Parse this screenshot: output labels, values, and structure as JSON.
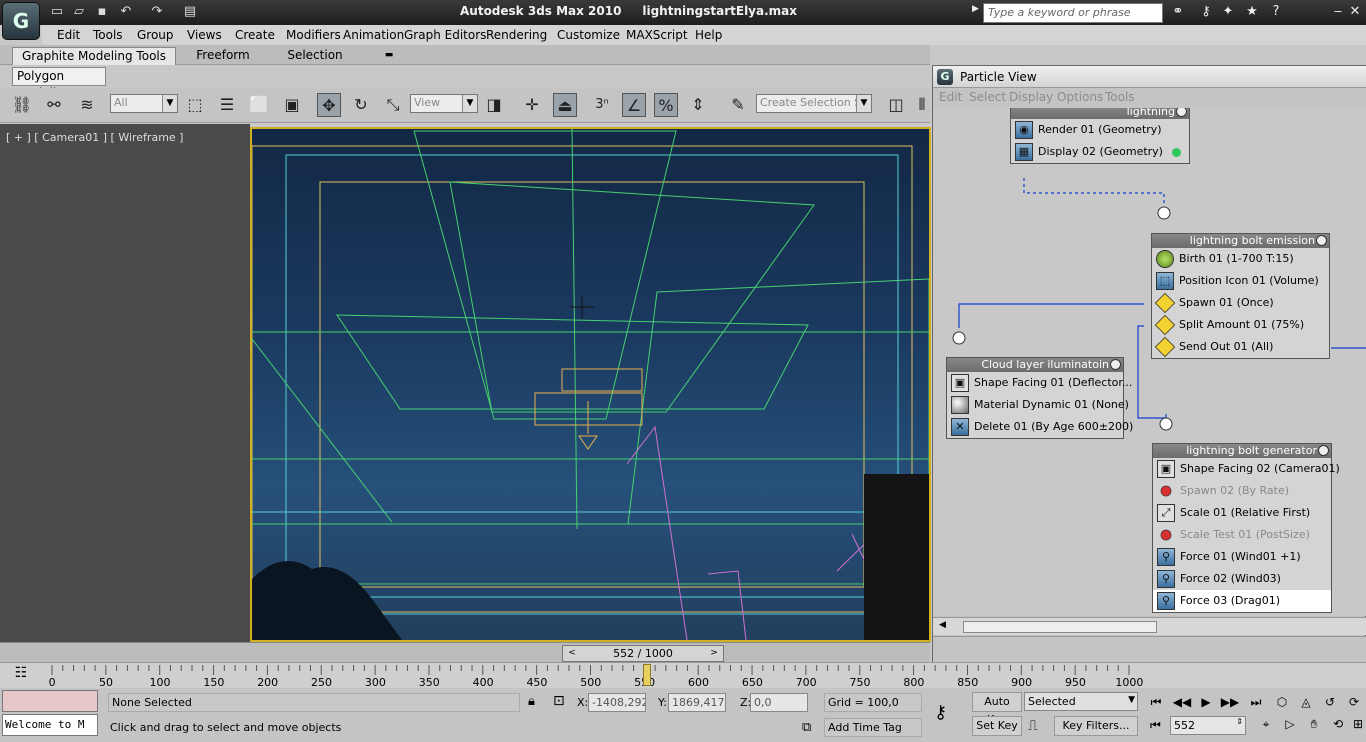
{
  "app": {
    "title": "Autodesk 3ds Max  2010",
    "file": "lightningstartElya.max",
    "logo_glyph": "G",
    "search_placeholder": "Type a keyword or phrase"
  },
  "menu": [
    "Edit",
    "Tools",
    "Group",
    "Views",
    "Create",
    "Modifiers",
    "Animation",
    "Graph Editors",
    "Rendering",
    "Customize",
    "MAXScript",
    "Help"
  ],
  "ribbon": {
    "tabs": [
      "Graphite Modeling Tools",
      "Freeform",
      "Selection"
    ],
    "sub_tab": "Polygon Modeling"
  },
  "toolbar": {
    "filter": "All",
    "coord": "View",
    "snap": "3",
    "selection_set": "Create Selection Se"
  },
  "viewport": {
    "label": "[ + ] [ Camera01 ] [ Wireframe ]"
  },
  "particle_view": {
    "title": "Particle View",
    "logo_glyph": "G",
    "menu": [
      "Edit",
      "Select",
      "Display",
      "Options",
      "Tools"
    ],
    "events": {
      "lightning": {
        "name": "lightning",
        "ops": [
          "Render 01 (Geometry)",
          "Display 02 (Geometry)"
        ]
      },
      "bolt_emission": {
        "name": "lightning bolt emission",
        "ops": [
          "Birth 01 (1-700 T:15)",
          "Position Icon 01 (Volume)",
          "Spawn 01 (Once)",
          "Split Amount 01 (75%)",
          "Send Out 01 (All)"
        ]
      },
      "cloud": {
        "name": "Cloud layer iluminatoin",
        "ops": [
          "Shape Facing 01 (Deflector...",
          "Material Dynamic 01 (None)",
          "Delete 01 (By Age 600±200)"
        ]
      },
      "bolt_generator": {
        "name": "lightning bolt generator",
        "ops": [
          "Shape Facing 02 (Camera01)",
          "Spawn 02 (By Rate)",
          "Scale 01 (Relative First)",
          "Scale Test 01 (PostSize)",
          "Force 01 (Wind01 +1)",
          "Force 02 (Wind03)",
          "Force 03 (Drag01)"
        ]
      }
    }
  },
  "time": {
    "frame_label": "552 / 1000",
    "current_frame": 552,
    "ticks": [
      "0",
      "50",
      "100",
      "150",
      "200",
      "250",
      "300",
      "350",
      "400",
      "450",
      "500",
      "550",
      "600",
      "650",
      "700",
      "750",
      "800",
      "850",
      "900",
      "950",
      "1000"
    ]
  },
  "status": {
    "selection": "None Selected",
    "prompt": "Click and drag to select and move objects",
    "listener": "Welcome to M",
    "x_label": "X:",
    "x": "-1408,292",
    "y_label": "Y:",
    "y": "1869,417",
    "z_label": "Z:",
    "z": "0,0",
    "grid": "Grid = 100,0",
    "add_time_tag": "Add Time Tag",
    "auto_key": "Auto Key",
    "set_key": "Set Key",
    "key_mode": "Selected",
    "key_filters": "Key Filters...",
    "frame_field": "552"
  }
}
